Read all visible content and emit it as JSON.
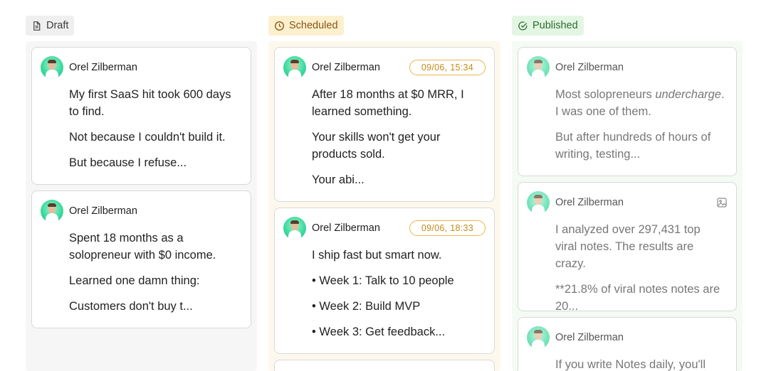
{
  "columns": {
    "draft": {
      "title": "Draft",
      "cards": [
        {
          "author": "Orel Zilberman",
          "paragraphs": [
            "My first SaaS hit took 600 days to find.",
            "Not because I couldn't build it.",
            "But because I refuse..."
          ]
        },
        {
          "author": "Orel Zilberman",
          "paragraphs": [
            "Spent 18 months as a solopreneur with $0 income.",
            "Learned one damn thing:",
            "Customers don't buy t..."
          ]
        }
      ]
    },
    "scheduled": {
      "title": "Scheduled",
      "cards": [
        {
          "author": "Orel Zilberman",
          "time": "09/06, 15:34",
          "paragraphs": [
            "After 18 months at $0 MRR, I learned something.",
            "Your skills won't get your products sold.",
            "Your abi..."
          ]
        },
        {
          "author": "Orel Zilberman",
          "time": "09/06, 18:33",
          "paragraphs": [
            "I ship fast but smart now.",
            "• Week 1: Talk to 10 people",
            "• Week 2: Build MVP",
            "• Week 3: Get feedback..."
          ]
        }
      ]
    },
    "published": {
      "title": "Published",
      "cards": [
        {
          "author": "Orel Zilberman",
          "p1_before": "Most solopreneurs ",
          "p1_em": "undercharge",
          "p1_after": ". I was one of them.",
          "p2": "But after hundreds of hours of writing, testing..."
        },
        {
          "author": "Orel Zilberman",
          "icon": "image-icon",
          "paragraphs": [
            "I analyzed over 297,431 top viral notes. The results are crazy.",
            "**21.8% of viral notes notes are 20..."
          ]
        },
        {
          "author": "Orel Zilberman",
          "paragraphs": [
            "If you write Notes daily, you'll"
          ]
        }
      ]
    }
  },
  "colors": {
    "draft_badge": "#efefef",
    "scheduled_badge": "#fdf0cf",
    "published_badge": "#e3f6e3",
    "scheduled_accent": "#e9b64a",
    "avatar_bg": "#3ddba0"
  }
}
